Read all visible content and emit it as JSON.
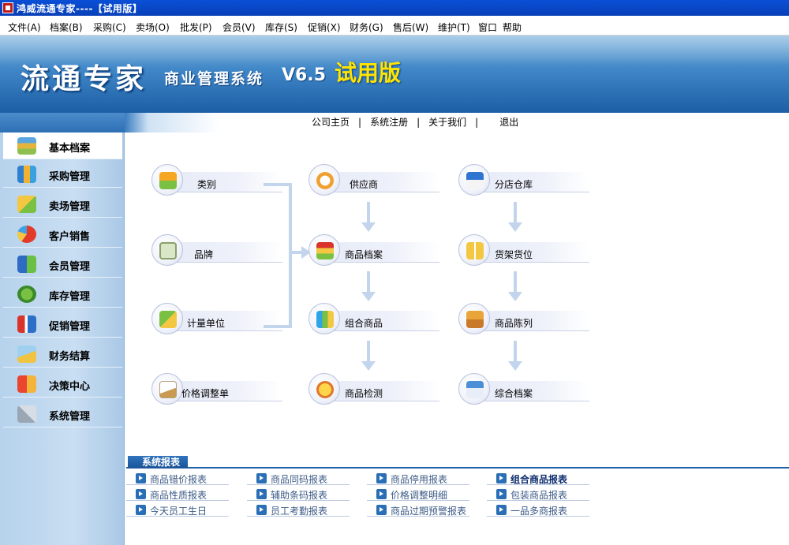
{
  "window": {
    "title": "鸿威流通专家----【试用版】"
  },
  "menu": [
    {
      "label": "文件(A)"
    },
    {
      "label": "档案(B)"
    },
    {
      "label": "采购(C)"
    },
    {
      "label": "卖场(O)"
    },
    {
      "label": "批发(P)"
    },
    {
      "label": "会员(V)"
    },
    {
      "label": "库存(S)"
    },
    {
      "label": "促销(X)"
    },
    {
      "label": "财务(G)"
    },
    {
      "label": "售后(W)"
    },
    {
      "label": "维护(T)"
    },
    {
      "label": "窗口"
    },
    {
      "label": "帮助"
    }
  ],
  "banner": {
    "name": "流通专家",
    "subtitle": "商业管理系统",
    "version": "V6.5",
    "edition": "试用版"
  },
  "sidebar": {
    "items": [
      {
        "label": "基本档案",
        "icon": "books-icon",
        "active": true
      },
      {
        "label": "采购管理",
        "icon": "bar-chart-icon"
      },
      {
        "label": "卖场管理",
        "icon": "pencil-icon"
      },
      {
        "label": "客户销售",
        "icon": "pie-chart-icon"
      },
      {
        "label": "会员管理",
        "icon": "members-icon"
      },
      {
        "label": "库存管理",
        "icon": "stock-icon"
      },
      {
        "label": "促销管理",
        "icon": "gift-icon"
      },
      {
        "label": "财务结算",
        "icon": "calculator-icon"
      },
      {
        "label": "决策中心",
        "icon": "decision-icon"
      },
      {
        "label": "系统管理",
        "icon": "tools-icon"
      }
    ]
  },
  "toplinks": {
    "home": "公司主页",
    "register": "系统注册",
    "about": "关于我们",
    "exit": "退出",
    "separator": "|"
  },
  "flow": {
    "category": "类别",
    "brand": "品牌",
    "unit": "计量单位",
    "price_adjust": "价格调整单",
    "supplier": "供应商",
    "product_archive": "商品档案",
    "combo_product": "组合商品",
    "product_check": "商品检测",
    "branch_warehouse": "分店仓库",
    "shelf_location": "货架货位",
    "product_display": "商品陈列",
    "general_archive": "综合档案"
  },
  "reports": {
    "title": "系统报表",
    "columns": [
      [
        "商品错价报表",
        "商品性质报表",
        "今天员工生日"
      ],
      [
        "商品同码报表",
        "辅助条码报表",
        "员工考勤报表"
      ],
      [
        "商品停用报表",
        "价格调整明细",
        "商品过期预警报表"
      ],
      [
        "组合商品报表",
        "包装商品报表",
        "一品多商报表"
      ]
    ]
  },
  "colors": {
    "accent": "#1f5fa6",
    "banner_top": "#7db3de",
    "banner_bottom": "#1d5ea5",
    "trial": "#ffe400"
  }
}
